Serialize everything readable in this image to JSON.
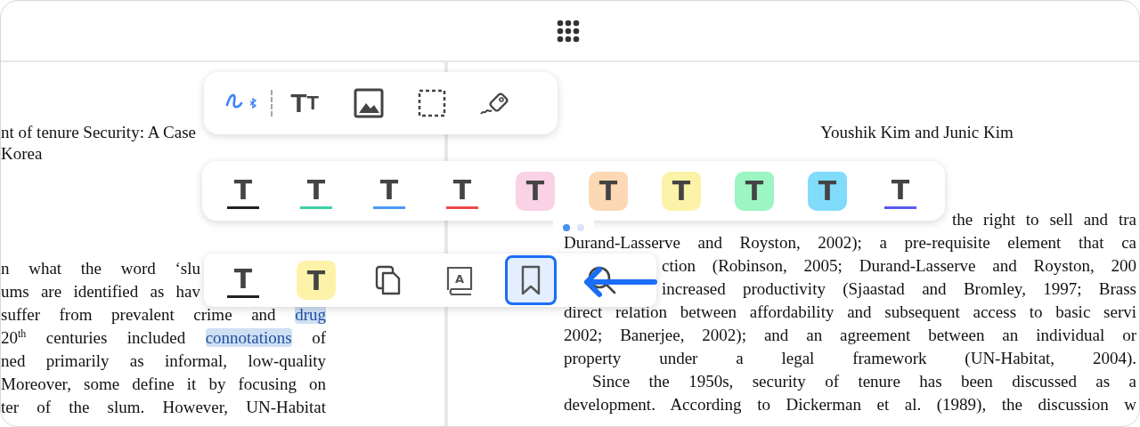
{
  "left_page": {
    "heading_lines": [
      "nt of tenure Security: A Case",
      "Korea"
    ],
    "body_lines": [
      {
        "parts": [
          {
            "text": "n what the word ‘slu",
            "highlighted": false
          }
        ]
      },
      {
        "parts": [
          {
            "text": "ums are identified as hav",
            "highlighted": false
          }
        ]
      },
      {
        "parts": [
          {
            "text": "suffer from prevalent crime and ",
            "highlighted": false
          },
          {
            "text": "drug",
            "highlighted": true
          }
        ]
      },
      {
        "parts": [
          {
            "text": "20$^{th}$ centuries included ",
            "highlighted": false
          },
          {
            "text": "connotations",
            "highlighted": true
          },
          {
            "text": " of",
            "highlighted": false
          }
        ]
      },
      {
        "parts": [
          {
            "text": "ned primarily as informal, low-quality",
            "highlighted": false
          }
        ]
      },
      {
        "parts": [
          {
            "text": "Moreover, some define it by focusing on",
            "highlighted": false
          }
        ]
      },
      {
        "parts": [
          {
            "text": "ter of the slum. However, UN-Habitat",
            "highlighted": false
          }
        ]
      }
    ]
  },
  "right_page": {
    "running_head": "Youshik Kim and Junic Kim",
    "body_lines": [
      {
        "parts": [
          {
            "text": "the right to sell and tra",
            "highlighted": false
          }
        ]
      },
      {
        "parts": [
          {
            "text": "Durand-Lasserve and Royston, 2002); a pre-requisite element that ca",
            "highlighted": false
          }
        ]
      },
      {
        "parts": [
          {
            "text": "ction (Robinson, 2005; Durand-Lasserve and Royston, 200",
            "highlighted": false
          }
        ]
      },
      {
        "parts": [
          {
            "text": "increased productivity (Sjaastad and Bromley, 1997; Brass",
            "highlighted": false
          }
        ]
      },
      {
        "parts": [
          {
            "text": "direct relation between affordability and subsequent access to basic servi",
            "highlighted": false
          }
        ]
      },
      {
        "parts": [
          {
            "text": "2002; Banerjee, 2002); and an agreement between an individual or",
            "highlighted": false
          }
        ]
      },
      {
        "parts": [
          {
            "text": "property under a legal framework (UN-Habitat, 2004).",
            "highlighted": false
          }
        ]
      },
      {
        "parts": [
          {
            "text": "Since the 1950s, security of tenure has been discussed as a",
            "highlighted": false
          }
        ]
      },
      {
        "parts": [
          {
            "text": "development. According to Dickerman et al. (1989), the discussion w",
            "highlighted": false
          }
        ]
      }
    ]
  },
  "drawing_tools": [
    {
      "kind": "pen",
      "selected": true
    },
    {
      "kind": "text",
      "label": "TT",
      "selected": false
    },
    {
      "kind": "image",
      "selected": false
    },
    {
      "kind": "select",
      "selected": false
    },
    {
      "kind": "eraser",
      "selected": false
    }
  ],
  "markup_styles": [
    {
      "kind": "underline",
      "label": "T",
      "color": "#222222"
    },
    {
      "kind": "underline",
      "label": "T",
      "color": "#3ecfa8"
    },
    {
      "kind": "underline",
      "label": "T",
      "color": "#4a9af5"
    },
    {
      "kind": "underline",
      "label": "T",
      "color": "#f04848"
    },
    {
      "kind": "highlight",
      "label": "T",
      "color": "#f9d2e6"
    },
    {
      "kind": "highlight",
      "label": "T",
      "color": "#fcd8b4"
    },
    {
      "kind": "highlight",
      "label": "T",
      "color": "#fdf3a8"
    },
    {
      "kind": "highlight",
      "label": "T",
      "color": "#9cf5c2"
    },
    {
      "kind": "highlight",
      "label": "T",
      "color": "#80dcfa"
    },
    {
      "kind": "underline",
      "label": "T",
      "color": "#5a5af0"
    }
  ],
  "pager": [
    {
      "selected": true
    },
    {
      "selected": false
    }
  ],
  "selection_actions": [
    {
      "kind": "underline",
      "label": "T",
      "color": "#222222",
      "selected": false
    },
    {
      "kind": "highlight",
      "label": "T",
      "color": "#fdf3a8",
      "selected": false
    },
    {
      "kind": "copy",
      "selected": false
    },
    {
      "kind": "dictionary",
      "label": "A",
      "selected": false
    },
    {
      "kind": "bookmark",
      "selected": true
    },
    {
      "kind": "search",
      "selected": false
    }
  ]
}
